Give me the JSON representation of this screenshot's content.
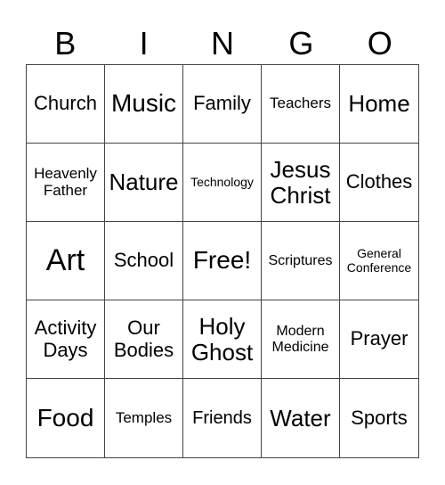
{
  "header": [
    "B",
    "I",
    "N",
    "G",
    "O"
  ],
  "cells": [
    "Church",
    "Music",
    "Family",
    "Teachers",
    "Home",
    "Heavenly Father",
    "Nature",
    "Technology",
    "Jesus Christ",
    "Clothes",
    "Art",
    "School",
    "Free!",
    "Scriptures",
    "General Conference",
    "Activity Days",
    "Our Bodies",
    "Holy Ghost",
    "Modern Medicine",
    "Prayer",
    "Food",
    "Temples",
    "Friends",
    "Water",
    "Sports"
  ]
}
